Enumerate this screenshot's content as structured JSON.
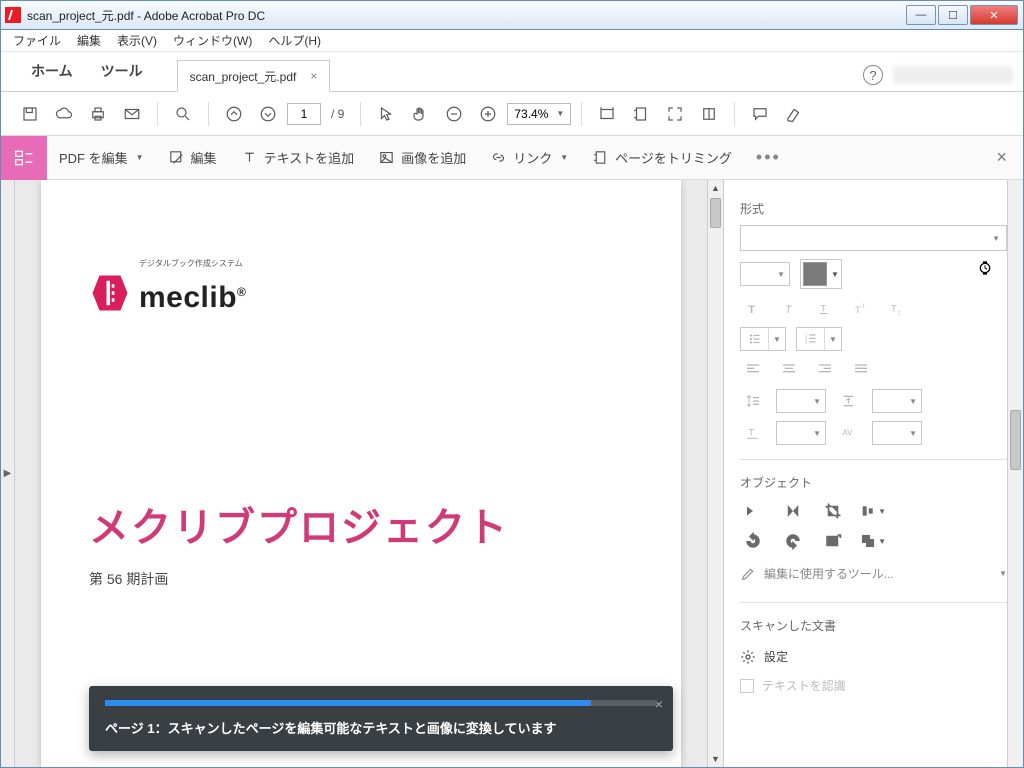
{
  "window": {
    "title": "scan_project_元.pdf - Adobe Acrobat Pro DC"
  },
  "menu": {
    "file": "ファイル",
    "edit": "編集",
    "view": "表示(V)",
    "window": "ウィンドウ(W)",
    "help": "ヘルプ(H)"
  },
  "tabs": {
    "home": "ホーム",
    "tools": "ツール",
    "doc": "scan_project_元.pdf"
  },
  "toolbar": {
    "page": "1",
    "pages_total": "/ 9",
    "zoom": "73.4%"
  },
  "editbar": {
    "edit_pdf": "PDF を編集",
    "edit": "編集",
    "add_text": "テキストを追加",
    "add_image": "画像を追加",
    "link": "リンク",
    "trim_page": "ページをトリミング"
  },
  "document": {
    "logo_tag": "デジタルブック作成システム",
    "logo_text": "meclib",
    "title": "メクリブプロジェクト",
    "subtitle": "第 56 期計画"
  },
  "toast": {
    "progress_pct": 88,
    "message": "ページ 1：スキャンしたページを編集可能なテキストと画像に変換しています"
  },
  "rpanel": {
    "format": "形式",
    "object": "オブジェクト",
    "edit_tools": "編集に使用するツール...",
    "scanned_doc": "スキャンした文書",
    "settings": "設定",
    "recognize_text": "テキストを認識"
  }
}
